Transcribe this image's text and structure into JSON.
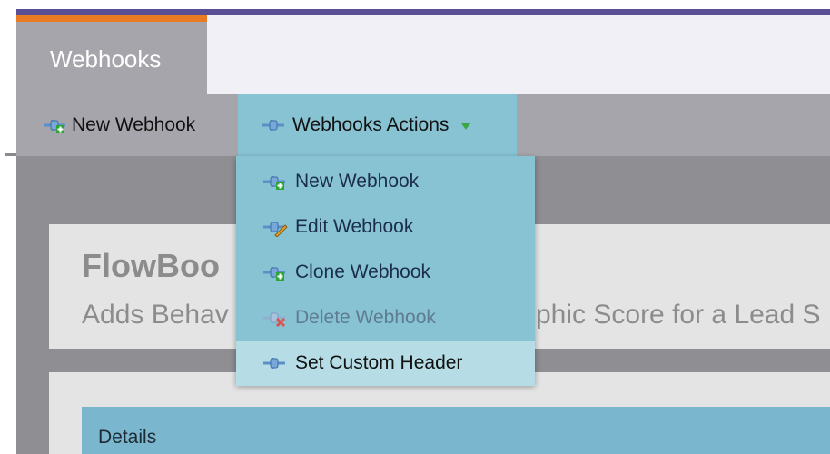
{
  "tabs": [
    {
      "label": "Webhooks"
    }
  ],
  "toolbar": {
    "new_webhook_label": "New Webhook",
    "actions_label": "Webhooks Actions"
  },
  "menu": {
    "items": [
      {
        "label": "New Webhook",
        "icon": "new-webhook-icon",
        "state": "enabled"
      },
      {
        "label": "Edit Webhook",
        "icon": "edit-webhook-icon",
        "state": "enabled"
      },
      {
        "label": "Clone Webhook",
        "icon": "clone-webhook-icon",
        "state": "enabled"
      },
      {
        "label": "Delete Webhook",
        "icon": "delete-webhook-icon",
        "state": "disabled"
      },
      {
        "label": "Set Custom Header",
        "icon": "webhook-icon",
        "state": "hovered"
      }
    ]
  },
  "card": {
    "title": "FlowBoo",
    "subtitle_left": "Adds Behav",
    "subtitle_right": "phic Score for a Lead S"
  },
  "details": {
    "label": "Details"
  },
  "colors": {
    "accent_orange": "#ea7a23",
    "top_bar": "#5a4f95",
    "menu_bg": "#88c3d3",
    "menu_highlight": "#b6dde6",
    "toolbar_gray": "#a6a5ab"
  }
}
